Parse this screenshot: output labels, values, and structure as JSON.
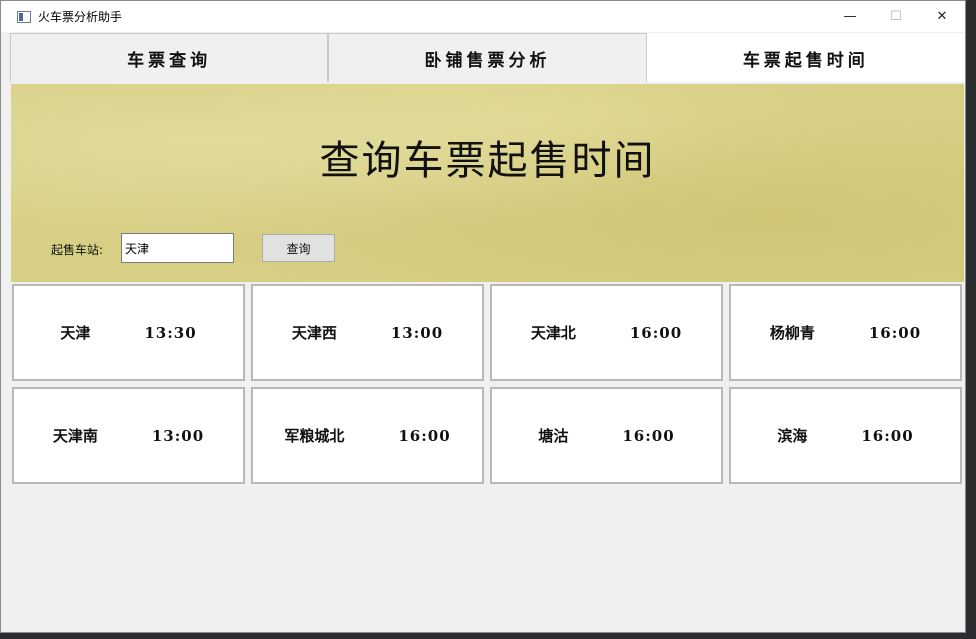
{
  "window": {
    "title": "火车票分析助手"
  },
  "tabs": [
    {
      "label": "车票查询",
      "active": false
    },
    {
      "label": "卧铺售票分析",
      "active": false
    },
    {
      "label": "车票起售时间",
      "active": true
    }
  ],
  "banner": {
    "title": "查询车票起售时间"
  },
  "form": {
    "station_label": "起售车站:",
    "station_value": "天津",
    "query_label": "查询"
  },
  "stations": [
    {
      "name": "天津",
      "time": "13:30"
    },
    {
      "name": "天津西",
      "time": "13:00"
    },
    {
      "name": "天津北",
      "time": "16:00"
    },
    {
      "name": "杨柳青",
      "time": "16:00"
    },
    {
      "name": "天津南",
      "time": "13:00"
    },
    {
      "name": "军粮城北",
      "time": "16:00"
    },
    {
      "name": "塘沽",
      "time": "16:00"
    },
    {
      "name": "滨海",
      "time": "16:00"
    }
  ]
}
